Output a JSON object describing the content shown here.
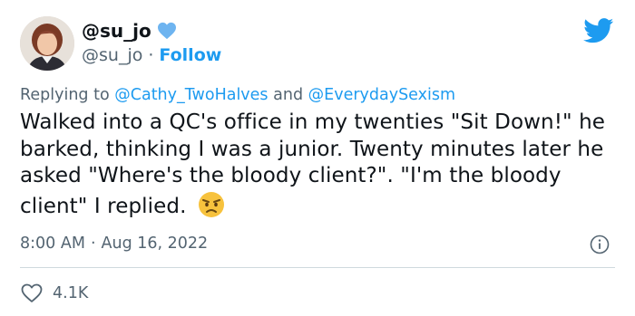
{
  "author": {
    "display_name": "@su_jo",
    "handle": "@su_jo",
    "separator": "·",
    "follow_label": "Follow"
  },
  "reply": {
    "prefix": "Replying to",
    "mention_1": "@Cathy_TwoHalves",
    "conjunction": "and",
    "mention_2": "@EverydaySexism"
  },
  "tweet": {
    "text": "Walked into a QC's office in my twenties \"Sit Down!\" he barked, thinking I was a junior. Twenty minutes later he asked \"Where's the bloody client?\". \"I'm the bloody client\" I replied.",
    "emoji": "angry-face-icon"
  },
  "meta": {
    "time": "8:00 AM",
    "separator": "·",
    "date": "Aug 16, 2022"
  },
  "stats": {
    "likes": "4.1K"
  },
  "icons": {
    "verified": "blue-heart-icon",
    "logo": "twitter-bird-icon",
    "info": "info-icon",
    "like": "heart-outline-icon"
  },
  "colors": {
    "accent": "#1d9bf0",
    "secondary_text": "#536471",
    "primary_text": "#0f1419",
    "divider": "#cfd9de"
  }
}
